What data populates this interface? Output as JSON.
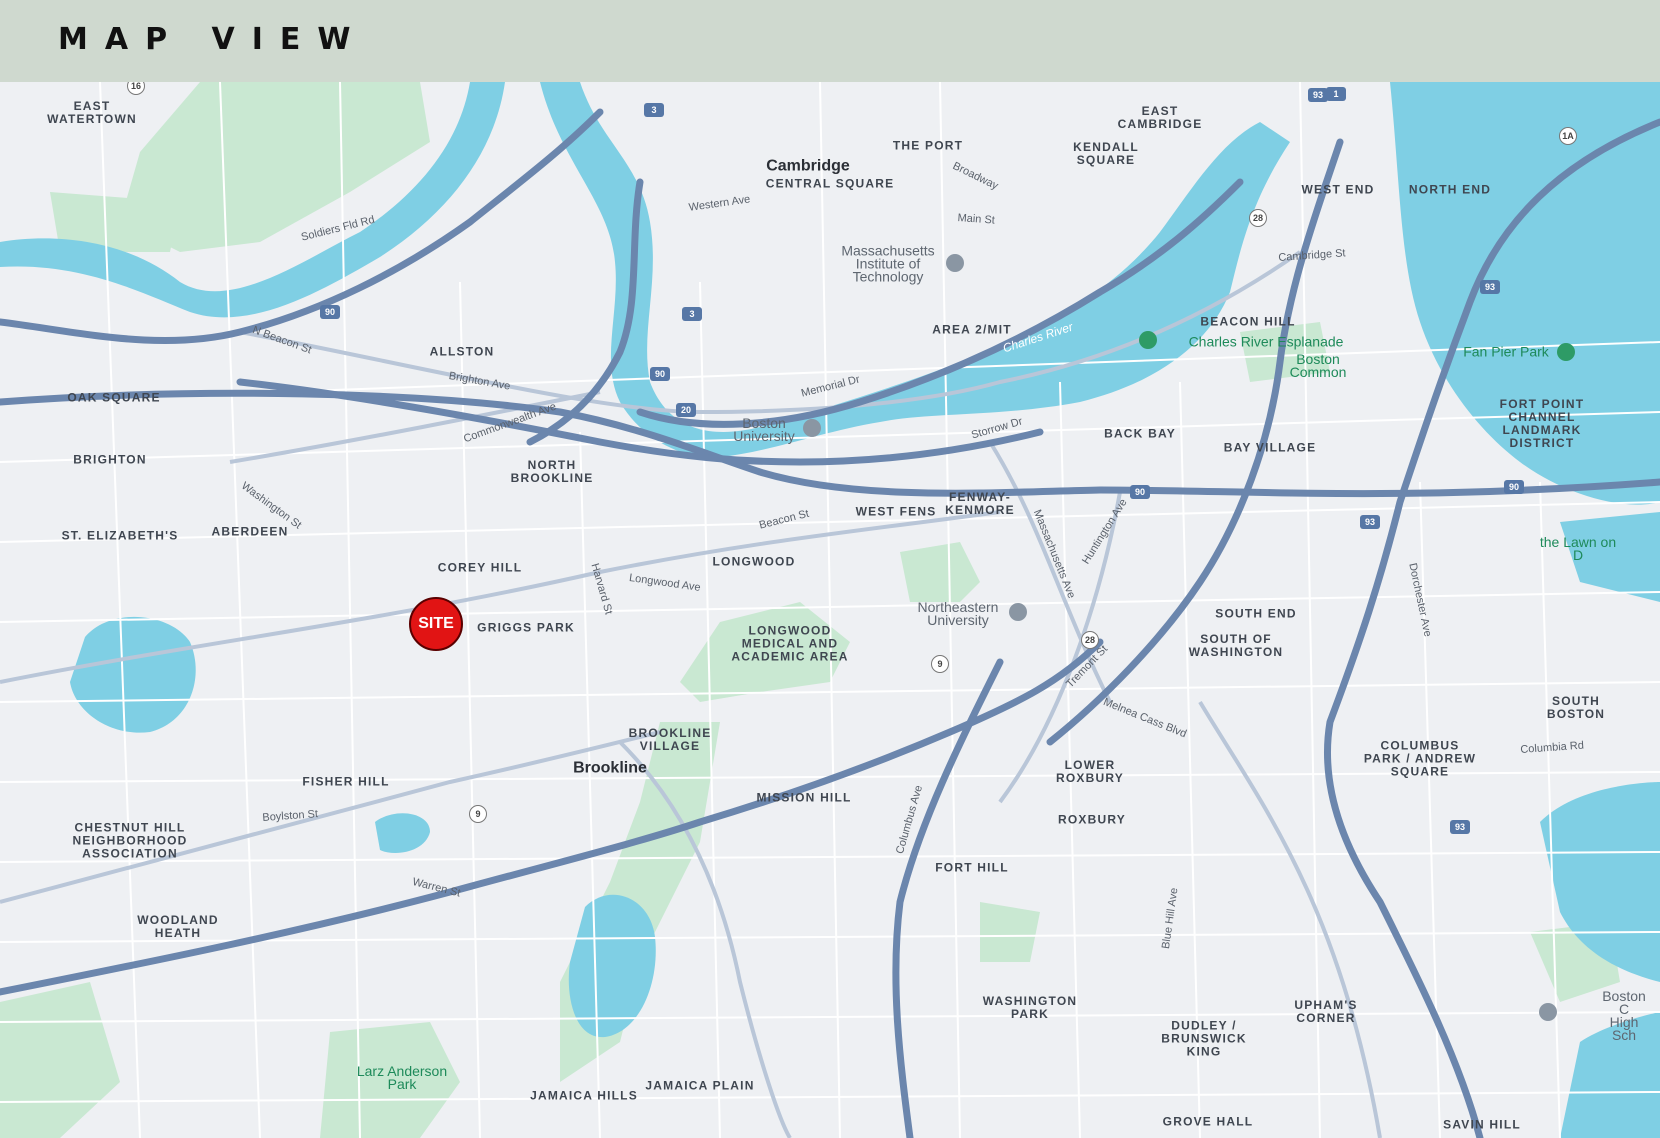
{
  "header": {
    "title": "MAP VIEW"
  },
  "map": {
    "site_marker": {
      "label": "SITE"
    },
    "neighborhoods": [
      "EAST\nWATERTOWN",
      "EAST\nCAMBRIDGE",
      "THE PORT",
      "KENDALL\nSQUARE",
      "WEST END",
      "NORTH END",
      "CENTRAL SQUARE",
      "ALLSTON",
      "OAK SQUARE",
      "BRIGHTON",
      "NORTH\nBROOKLINE",
      "ST. ELIZABETH'S",
      "ABERDEEN",
      "COREY HILL",
      "GRIGGS PARK",
      "LONGWOOD",
      "WEST FENS",
      "FENWAY-\nKENMORE",
      "BACK BAY",
      "BAY VILLAGE",
      "BEACON HILL",
      "AREA 2/MIT",
      "FORT POINT\nCHANNEL\nLANDMARK\nDISTRICT",
      "SOUTH END",
      "SOUTH OF\nWASHINGTON",
      "LONGWOOD\nMEDICAL AND\nACADEMIC AREA",
      "BROOKLINE\nVILLAGE",
      "MISSION HILL",
      "FISHER HILL",
      "CHESTNUT HILL\nNEIGHBORHOOD\nASSOCIATION",
      "WOODLAND\nHEATH",
      "LOWER\nROXBURY",
      "ROXBURY",
      "FORT HILL",
      "SOUTH BOSTON",
      "COLUMBUS\nPARK / ANDREW\nSQUARE",
      "WASHINGTON\nPARK",
      "DUDLEY /\nBRUNSWICK\nKING",
      "UPHAM'S\nCORNER",
      "JAMAICA HILLS",
      "JAMAICA PLAIN",
      "GROVE HALL",
      "SAVIN HILL"
    ],
    "cities": [
      "Cambridge",
      "Brookline"
    ],
    "pois": [
      "Massachusetts\nInstitute of\nTechnology",
      "Boston\nUniversity",
      "Northeastern\nUniversity",
      "Boston C\nHigh Sch"
    ],
    "parks": [
      "Charles River Esplanade",
      "Boston\nCommon",
      "Fan Pier Park",
      "the Lawn on D",
      "Larz Anderson\nPark"
    ],
    "water": [
      "Charles River"
    ],
    "streets": [
      "Soldiers Fld Rd",
      "N Beacon St",
      "Brighton Ave",
      "Commonwealth Ave",
      "Beacon St",
      "Memorial Dr",
      "Storrow Dr",
      "Western Ave",
      "Cambridge St",
      "Massachusetts Ave",
      "Huntington Ave",
      "Tremont St",
      "Columbus Ave",
      "Boylston St",
      "Washington St",
      "Harvard St",
      "Longwood Ave",
      "Main St",
      "Broadway",
      "Warren St",
      "Dorchester Ave",
      "Melnea Cass Blvd",
      "Blue Hill Ave",
      "Columbia Rd"
    ],
    "highway_shields": [
      "90",
      "90",
      "90",
      "90",
      "93",
      "93",
      "93",
      "93",
      "9",
      "9",
      "28",
      "28",
      "3",
      "3",
      "20",
      "1",
      "16",
      "1A"
    ]
  }
}
